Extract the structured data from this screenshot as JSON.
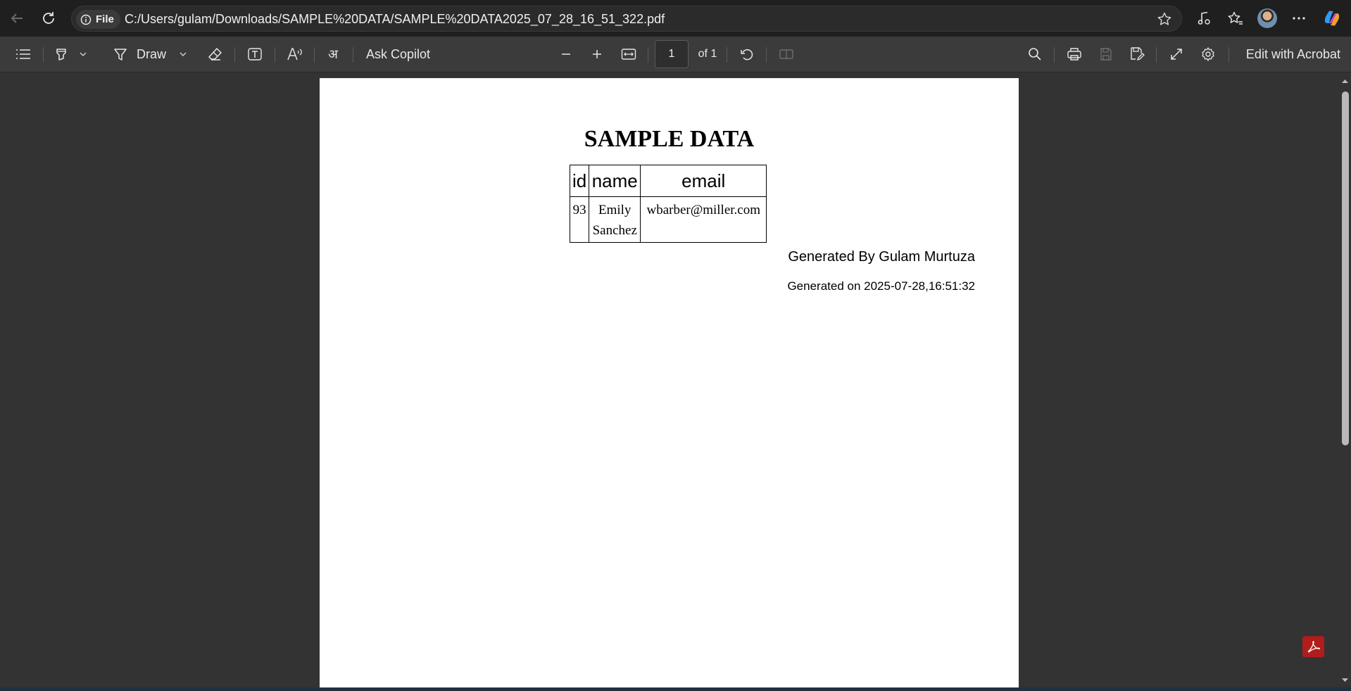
{
  "browser": {
    "file_chip": "File",
    "url": "C:/Users/gulam/Downloads/SAMPLE%20DATA/SAMPLE%20DATA2025_07_28_16_51_322.pdf"
  },
  "toolbar": {
    "draw_label": "Draw",
    "ask_copilot_label": "Ask Copilot",
    "page_number": "1",
    "page_total": "of 1",
    "edit_acrobat_label": "Edit with Acrobat"
  },
  "document": {
    "title": "SAMPLE DATA",
    "table": {
      "headers": [
        "id",
        "name",
        "email"
      ],
      "rows": [
        {
          "id": "93",
          "name_first": "Emily",
          "name_last": "Sanchez",
          "email": "wbarber@miller.com"
        }
      ]
    },
    "generated_by": "Generated By Gulam Murtuza",
    "generated_on": "Generated on 2025-07-28,16:51:32"
  },
  "colors": {
    "chrome_bg": "#1f1f1f",
    "toolbar_bg": "#3b3b3b",
    "viewer_bg": "#333333",
    "acrobat_red": "#b11c1c"
  }
}
